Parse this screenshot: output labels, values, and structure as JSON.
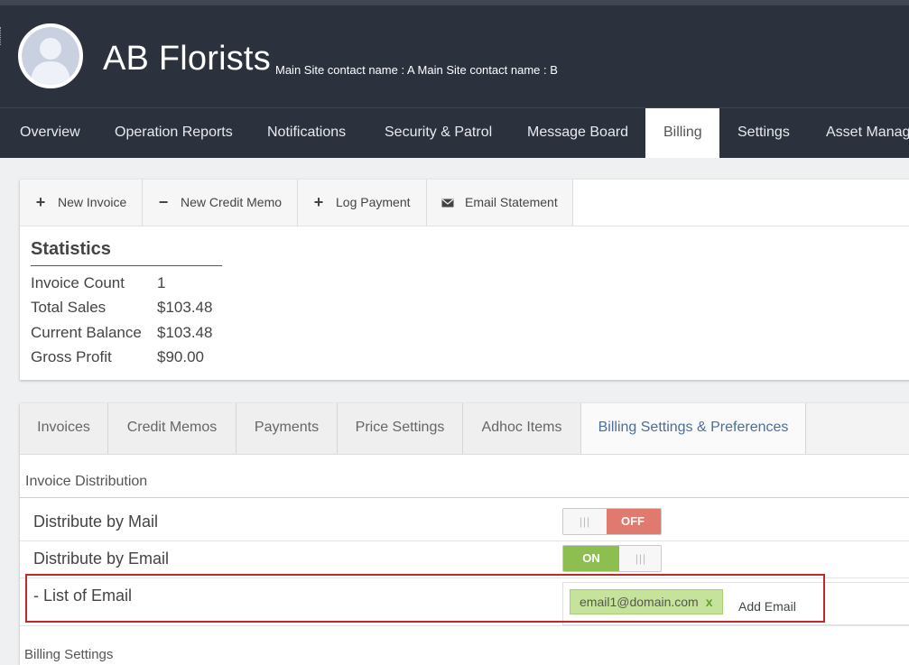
{
  "header": {
    "company_name": "AB Florists",
    "contact_line": "Main Site contact name : A Main Site contact name : B"
  },
  "nav": {
    "items": [
      {
        "label": "Overview"
      },
      {
        "label": "Operation Reports"
      },
      {
        "label": "Notifications"
      },
      {
        "label": "Security & Patrol"
      },
      {
        "label": "Message Board"
      },
      {
        "label": "Billing",
        "active": true
      },
      {
        "label": "Settings"
      },
      {
        "label": "Asset Manag"
      }
    ]
  },
  "toolbar": {
    "buttons": [
      {
        "label": "New Invoice",
        "icon": "plus-icon"
      },
      {
        "label": "New Credit Memo",
        "icon": "minus-icon"
      },
      {
        "label": "Log Payment",
        "icon": "plus-icon"
      },
      {
        "label": "Email Statement",
        "icon": "envelope-icon"
      }
    ]
  },
  "statistics": {
    "title": "Statistics",
    "rows": [
      {
        "label": "Invoice Count",
        "value": "1"
      },
      {
        "label": "Total Sales",
        "value": "$103.48"
      },
      {
        "label": "Current Balance",
        "value": "$103.48"
      },
      {
        "label": "Gross Profit",
        "value": "$90.00"
      }
    ]
  },
  "tabs": [
    {
      "label": "Invoices"
    },
    {
      "label": "Credit Memos"
    },
    {
      "label": "Payments"
    },
    {
      "label": "Price Settings"
    },
    {
      "label": "Adhoc Items"
    },
    {
      "label": "Billing Settings & Preferences",
      "active": true
    }
  ],
  "distribution": {
    "section_title": "Invoice Distribution",
    "mail": {
      "label": "Distribute by Mail",
      "state": "OFF"
    },
    "email": {
      "label": "Distribute by Email",
      "state": "ON"
    },
    "email_list": {
      "label": "- List of Email",
      "emails": [
        "email1@domain.com"
      ],
      "remove_glyph": "x",
      "add_label": "Add Email"
    }
  },
  "next_section_title": "Billing Settings",
  "colors": {
    "header_bg": "#2b313d",
    "toggle_off": "#e07a6e",
    "toggle_on": "#8cbf4f",
    "email_tag": "#c5e39a",
    "highlight": "#c0282e",
    "active_tab_text": "#4a6f9a"
  }
}
